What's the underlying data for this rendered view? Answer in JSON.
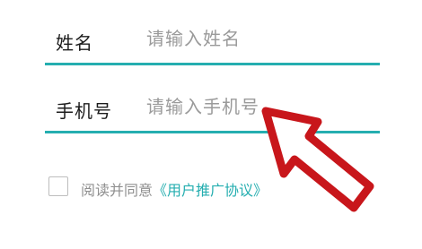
{
  "form": {
    "name_label": "姓名",
    "name_placeholder": "请输入姓名",
    "name_value": "",
    "phone_label": "手机号",
    "phone_placeholder": "请输入手机号",
    "phone_value": ""
  },
  "agreement": {
    "checked": false,
    "text": "阅读并同意",
    "link_text": "《用户推广协议》"
  },
  "colors": {
    "accent": "#25aeb0",
    "placeholder": "#9a9a9a",
    "arrow": "#c8161b"
  },
  "overlay": {
    "icon": "pointer-arrow-icon"
  }
}
